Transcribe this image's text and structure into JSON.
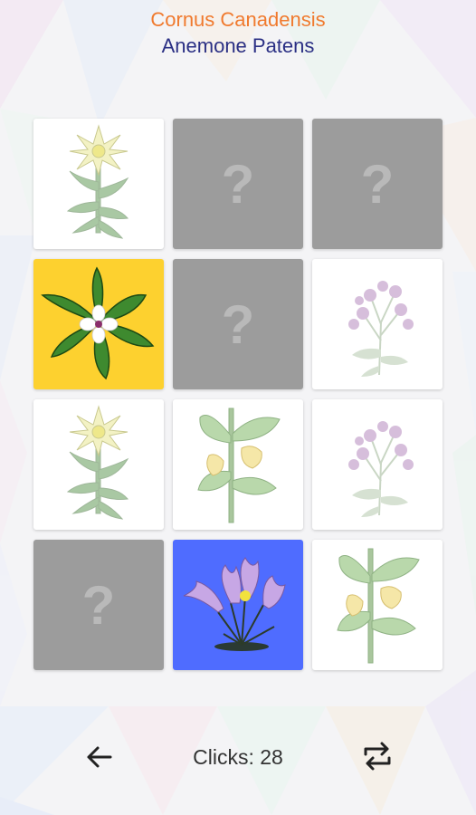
{
  "header": {
    "title_primary": "Cornus Canadensis",
    "title_secondary": "Anemone Patens"
  },
  "board": {
    "hidden_label": "?",
    "cards": [
      {
        "state": "revealed",
        "flower": "leontopodium-edelweiss-icon",
        "bg": "#ffffff"
      },
      {
        "state": "hidden"
      },
      {
        "state": "hidden"
      },
      {
        "state": "revealed",
        "flower": "cornus-canadensis-icon",
        "bg": "#fdd12f"
      },
      {
        "state": "hidden"
      },
      {
        "state": "revealed",
        "flower": "purple-aster-icon",
        "bg": "#ffffff"
      },
      {
        "state": "revealed",
        "flower": "leontopodium-edelweiss-icon",
        "bg": "#ffffff"
      },
      {
        "state": "revealed",
        "flower": "yellow-bell-flower-icon",
        "bg": "#ffffff"
      },
      {
        "state": "revealed",
        "flower": "purple-aster-icon",
        "bg": "#ffffff"
      },
      {
        "state": "hidden"
      },
      {
        "state": "revealed",
        "flower": "anemone-patens-icon",
        "bg": "#4f6cff"
      },
      {
        "state": "revealed",
        "flower": "yellow-bell-flower-icon",
        "bg": "#ffffff"
      }
    ]
  },
  "footer": {
    "clicks_label": "Clicks: 28",
    "back_icon": "arrow-left-icon",
    "restart_icon": "repeat-icon"
  },
  "colors": {
    "title_primary": "#f07a2e",
    "title_secondary": "#2a2f84",
    "hidden_card": "#9c9c9c",
    "matched_yellow": "#fdd12f",
    "matched_blue": "#4f6cff"
  }
}
